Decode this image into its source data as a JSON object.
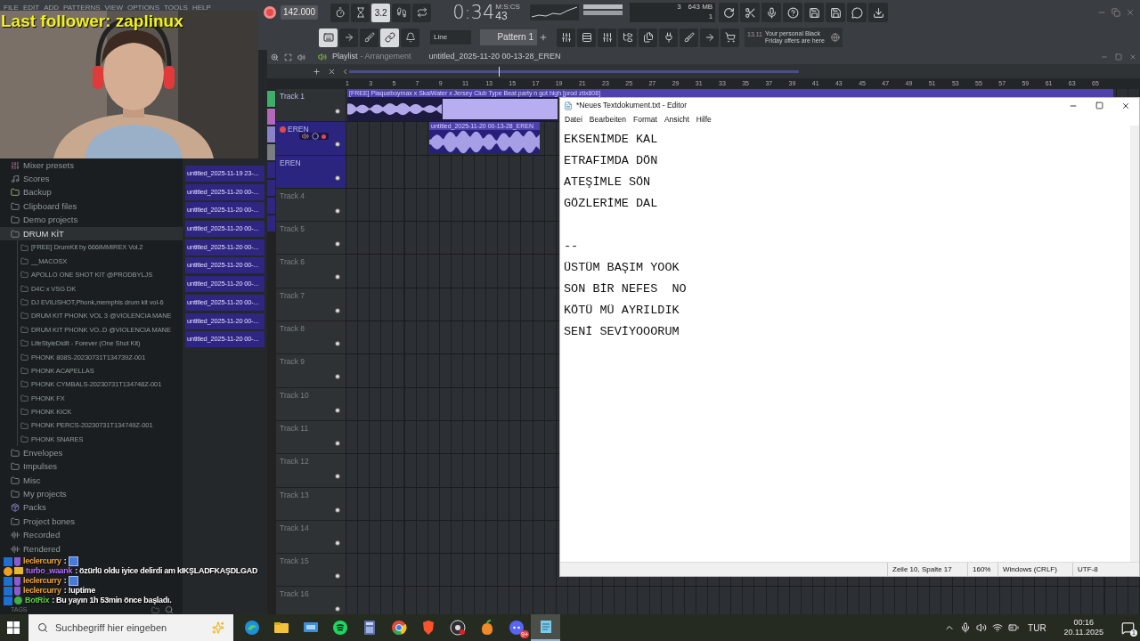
{
  "overlay": {
    "alert": "Last follower: zaplinux"
  },
  "fl": {
    "menu": [
      "FILE",
      "EDIT",
      "ADD",
      "PATTERNS",
      "VIEW",
      "OPTIONS",
      "TOOLS",
      "HELP"
    ],
    "tempo": "142.000",
    "time": "0:34",
    "time_cs": "43",
    "time_unit": "M:S:CS",
    "cpu": "3",
    "memory": "643 MB",
    "poly": "1",
    "transport_buttons": [
      {
        "kind": "metronome",
        "on": false
      },
      {
        "kind": "wait",
        "on": false
      },
      {
        "kind": "countdown",
        "label": "3.2",
        "on": true
      },
      {
        "kind": "step",
        "on": false
      },
      {
        "kind": "loop",
        "on": false
      }
    ],
    "view_buttons": [
      {
        "kind": "piano",
        "on": true
      },
      {
        "kind": "arrow",
        "on": false
      },
      {
        "kind": "brush",
        "on": false
      },
      {
        "kind": "link",
        "on": true
      },
      {
        "kind": "bell",
        "on": false
      }
    ],
    "snap": "Line",
    "pattern": "Pattern 1",
    "news": {
      "date": "13.11",
      "text": "Your personal Black Friday offers are here"
    }
  },
  "browser": {
    "items": [
      {
        "label": "Mixer presets",
        "kind": "mixer",
        "selected": false
      },
      {
        "label": "Scores",
        "kind": "note",
        "selected": false
      },
      {
        "label": "Backup",
        "kind": "backup",
        "selected": false
      },
      {
        "label": "Clipboard files",
        "kind": "folder",
        "selected": false
      },
      {
        "label": "Demo projects",
        "kind": "folder",
        "selected": false
      },
      {
        "label": "DRUM KİT",
        "kind": "folder",
        "selected": true,
        "children": [
          {
            "label": "[FREE] DrumKit by 666IMMIREX Vol.2"
          },
          {
            "label": "__MACOSX"
          },
          {
            "label": "APOLLO ONE SHOT KIT @PRODBYLJS"
          },
          {
            "label": "D4C x VSG DK"
          },
          {
            "label": "DJ EVILISHOT,Phonk,memphis drum kit vol-6"
          },
          {
            "label": "DRUM KIT PHONK VOL 3 @VIOLENCIA MANE"
          },
          {
            "label": "DRUM KIT PHONK VO..D @VIOLENCIA MANE"
          },
          {
            "label": "LifeStyleDidIt - Forever (One Shot Kit)"
          },
          {
            "label": "PHONK 808S-20230731T134739Z-001"
          },
          {
            "label": "PHONK ACAPELLAS"
          },
          {
            "label": "PHONK CYMBALS-20230731T134748Z-001"
          },
          {
            "label": "PHONK FX"
          },
          {
            "label": "PHONK KICK"
          },
          {
            "label": "PHONK PERCS-20230731T134749Z-001"
          },
          {
            "label": "PHONK SNARES"
          }
        ]
      },
      {
        "label": "Envelopes",
        "kind": "folder",
        "selected": false
      },
      {
        "label": "Impulses",
        "kind": "folder",
        "selected": false
      },
      {
        "label": "Misc",
        "kind": "plainfolder",
        "selected": false
      },
      {
        "label": "My projects",
        "kind": "folder",
        "selected": false
      },
      {
        "label": "Packs",
        "kind": "pack",
        "selected": false
      },
      {
        "label": "Project bones",
        "kind": "folder",
        "selected": false
      },
      {
        "label": "Recorded",
        "kind": "recorded",
        "selected": false
      },
      {
        "label": "Rendered",
        "kind": "rendered",
        "selected": false
      }
    ],
    "tags": "TAGS"
  },
  "patterns": [
    "untitled_2025-11-19 23-...",
    "untitled_2025-11-20 00-...",
    "untitled_2025-11-20 00-...",
    "untitled_2025-11-20 00-...",
    "untitled_2025-11-20 00-...",
    "untitled_2025-11-20 00-...",
    "untitled_2025-11-20 00-...",
    "untitled_2025-11-20 00-...",
    "untitled_2025-11-20 00-...",
    "untitled_2025-11-20 00-..."
  ],
  "playlist": {
    "title": "Playlist",
    "subtitle": "- Arrangement",
    "project": "untitled_2025-11-20 00-13-28_EREN",
    "ruler": [
      "1",
      "3",
      "5",
      "7",
      "9",
      "11",
      "13",
      "15",
      "17",
      "19",
      "21",
      "23",
      "25",
      "27",
      "29",
      "31",
      "33",
      "35",
      "37",
      "39",
      "41",
      "43",
      "45",
      "47",
      "49",
      "51",
      "53",
      "55",
      "57",
      "59",
      "61",
      "63",
      "65"
    ],
    "tracks": [
      {
        "name": "Track 1",
        "selected": false,
        "empty": false,
        "kind": "plain"
      },
      {
        "name": "EREN",
        "selected": true,
        "empty": false,
        "kind": "armed"
      },
      {
        "name": "EREN",
        "selected": true,
        "empty": false,
        "kind": "plain"
      },
      {
        "name": "Track 4",
        "selected": false,
        "empty": true,
        "kind": "plain"
      },
      {
        "name": "Track 5",
        "selected": false,
        "empty": true,
        "kind": "plain"
      },
      {
        "name": "Track 6",
        "selected": false,
        "empty": true,
        "kind": "plain"
      },
      {
        "name": "Track 7",
        "selected": false,
        "empty": true,
        "kind": "plain"
      },
      {
        "name": "Track 8",
        "selected": false,
        "empty": true,
        "kind": "plain"
      },
      {
        "name": "Track 9",
        "selected": false,
        "empty": true,
        "kind": "plain"
      },
      {
        "name": "Track 10",
        "selected": false,
        "empty": true,
        "kind": "plain"
      },
      {
        "name": "Track 11",
        "selected": false,
        "empty": true,
        "kind": "plain"
      },
      {
        "name": "Track 12",
        "selected": false,
        "empty": true,
        "kind": "plain"
      },
      {
        "name": "Track 13",
        "selected": false,
        "empty": true,
        "kind": "plain"
      },
      {
        "name": "Track 14",
        "selected": false,
        "empty": true,
        "kind": "plain"
      },
      {
        "name": "Track 15",
        "selected": false,
        "empty": true,
        "kind": "plain"
      },
      {
        "name": "Track 16",
        "selected": false,
        "empty": true,
        "kind": "plain"
      }
    ],
    "clips": [
      {
        "title": "[FREE] Plaqueboymax x SkaiWater x Jersey Club Type Beat party n got high [prod ztix808]",
        "kind": "beat"
      },
      {
        "title": "untitled_2025-11-20 00-13-28_EREN",
        "kind": "vocal"
      }
    ]
  },
  "notepad": {
    "title": "*Neues Textdokument.txt - Editor",
    "menu": [
      "Datei",
      "Bearbeiten",
      "Format",
      "Ansicht",
      "Hilfe"
    ],
    "text": "EKSENİMDE KAL\nETRAFIMDA DÖN\nATEŞİMLE SÖN\nGÖZLERİME DAL\n\n--\nÜSTÜM BAŞIM YOOK\nSON BİR NEFES  NO\nKÖTÜ MÜ AYRILDIK\nSENİ SEVİYOOORUM",
    "status": [
      "Zeile 10, Spalte 17",
      "160%",
      "Windows (CRLF)",
      "UTF-8"
    ]
  },
  "chat": [
    {
      "user": "leclercurry",
      "color": "#f2a33a",
      "text": ":",
      "emote": true,
      "kind": "mod"
    },
    {
      "user": "turbo_waank",
      "color": "#b06cff",
      "text": ": özürlü oldu iyice delirdi am kIKŞLADFKAŞDLGAD",
      "emote": false,
      "kind": "vip"
    },
    {
      "user": "leclercurry",
      "color": "#f2a33a",
      "text": ":",
      "emote": true,
      "kind": "mod"
    },
    {
      "user": "leclercurry",
      "color": "#f2a33a",
      "text": ": !uptime",
      "emote": false,
      "kind": "mod"
    },
    {
      "user": "BotRix",
      "color": "#5fd33f",
      "text": ": Bu yayın 1h 53min önce başladı.",
      "emote": false,
      "kind": "bot"
    }
  ],
  "taskbar": {
    "search": "Suchbegriff hier eingeben",
    "apps": [
      {
        "kind": "edge",
        "active": false
      },
      {
        "kind": "explorer",
        "active": false
      },
      {
        "kind": "monitor",
        "active": false
      },
      {
        "kind": "spotify",
        "active": false
      },
      {
        "kind": "calculator",
        "active": false
      },
      {
        "kind": "chrome",
        "active": false
      },
      {
        "kind": "brave",
        "active": false
      },
      {
        "kind": "obs",
        "active": false
      },
      {
        "kind": "fl",
        "active": false
      },
      {
        "kind": "discord",
        "active": false,
        "badge": "9+"
      },
      {
        "kind": "notepad",
        "active": true
      }
    ],
    "language": "TUR",
    "time": "00:16",
    "date": "20.11.2025",
    "notifications": "1"
  }
}
